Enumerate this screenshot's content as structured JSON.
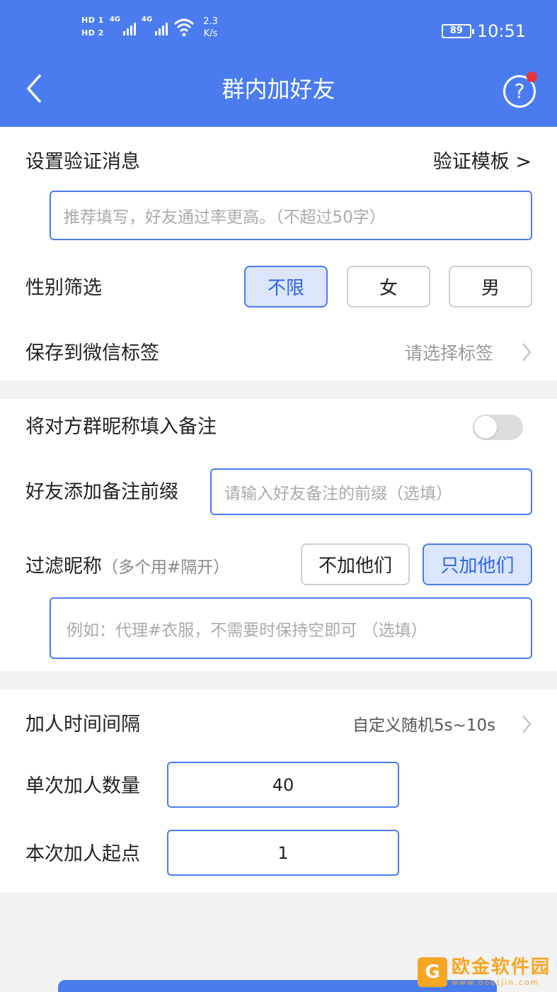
{
  "status_bar": {
    "hd1": "HD 1",
    "hd2": "HD 2",
    "net1": "4G",
    "net2": "4G",
    "speed_value": "2.3",
    "speed_unit": "K/s",
    "battery": "89",
    "time": "10:51"
  },
  "header": {
    "title": "群内加好友",
    "back_icon": "chevron-left-icon",
    "help_icon": "question-circle-icon"
  },
  "verify": {
    "label": "设置验证消息",
    "template_link": "验证模板 >",
    "placeholder": "推荐填写，好友通过率更高。（不超过50字）"
  },
  "gender": {
    "label": "性别筛选",
    "options": [
      "不限",
      "女",
      "男"
    ],
    "selected": "不限"
  },
  "tag": {
    "label": "保存到微信标签",
    "placeholder": "请选择标签"
  },
  "remark": {
    "fill_nick_label": "将对方群昵称填入备注",
    "fill_nick_on": false,
    "prefix_label": "好友添加备注前缀",
    "prefix_placeholder": "请输入好友备注的前缀（选填）"
  },
  "filter": {
    "label": "过滤昵称",
    "hint": "（多个用#隔开）",
    "options": [
      "不加他们",
      "只加他们"
    ],
    "selected": "只加他们",
    "placeholder": "例如：代理#衣服，不需要时保持空即可 （选填）"
  },
  "timing": {
    "interval_label": "加人时间间隔",
    "interval_value": "自定义随机5s~10s",
    "count_label": "单次加人数量",
    "count_value": "40",
    "start_label": "本次加人起点",
    "start_value": "1"
  },
  "watermark": {
    "name": "欧金软件园",
    "url": "www.ooutjin.com"
  },
  "colors": {
    "primary": "#4a7cf0",
    "chip_active_bg": "#dbe6fd",
    "badge": "#e8323a",
    "watermark": "#f5a623"
  }
}
